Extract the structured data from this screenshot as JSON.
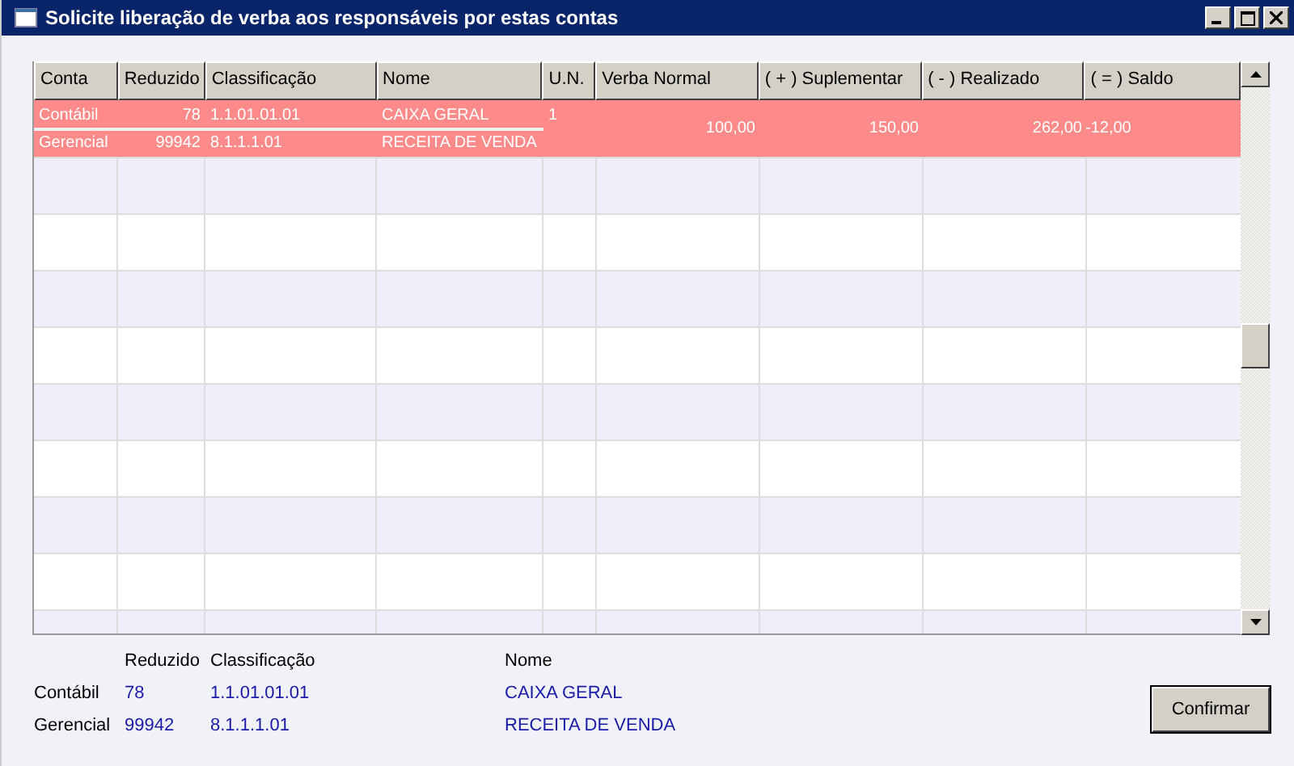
{
  "window": {
    "title": "Solicite liberação de verba aos responsáveis por estas contas"
  },
  "table": {
    "columns": [
      "Conta",
      "Reduzido",
      "Classificação",
      "Nome",
      "U.N.",
      "Verba Normal",
      "( + ) Suplementar",
      "( - ) Realizado",
      "( = ) Saldo"
    ],
    "rows": [
      {
        "selected": true,
        "accounts": [
          {
            "conta": "Contábil",
            "reduzido": "78",
            "classificacao": "1.1.01.01.01",
            "nome": "CAIXA GERAL"
          },
          {
            "conta": "Gerencial",
            "reduzido": "99942",
            "classificacao": "8.1.1.1.01",
            "nome": "RECEITA DE VENDA"
          }
        ],
        "un": "1",
        "verba_normal": "100,00",
        "suplementar": "150,00",
        "realizado": "262,00",
        "saldo": "-12,00"
      }
    ]
  },
  "summary": {
    "headers": [
      "Reduzido",
      "Classificação",
      "Nome"
    ],
    "rows": [
      {
        "label": "Contábil",
        "reduzido": "78",
        "classificacao": "1.1.01.01.01",
        "nome": "CAIXA GERAL"
      },
      {
        "label": "Gerencial",
        "reduzido": "99942",
        "classificacao": "8.1.1.1.01",
        "nome": "RECEITA DE VENDA"
      }
    ]
  },
  "confirm_button": "Confirmar"
}
